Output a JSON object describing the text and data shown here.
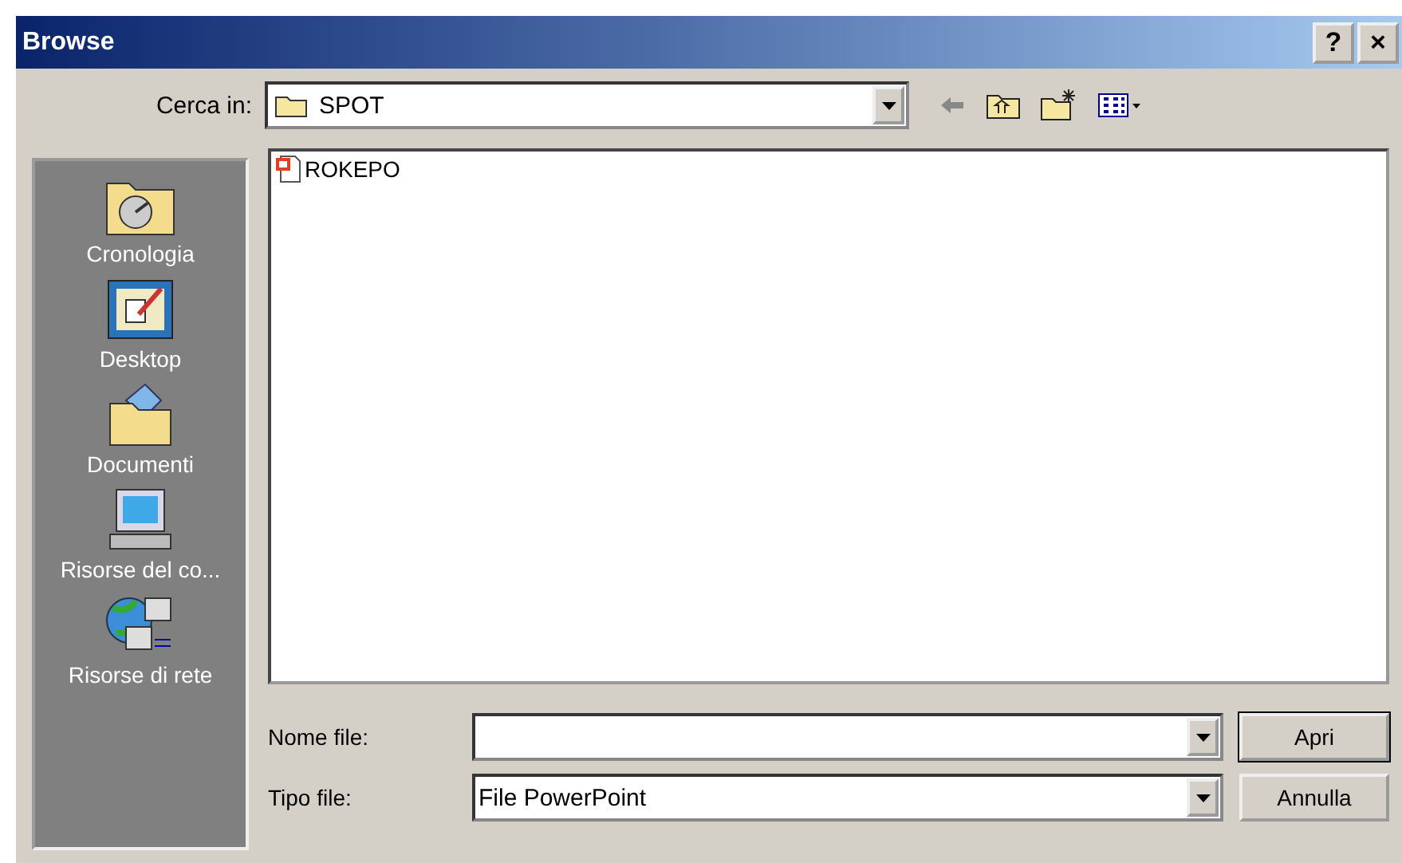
{
  "window": {
    "title": "Browse",
    "title_buttons": [
      "?",
      "×"
    ]
  },
  "look_in": {
    "label": "Cerca in:",
    "value": "SPOT"
  },
  "places": [
    {
      "label": "Cronologia",
      "kind": "history"
    },
    {
      "label": "Desktop",
      "kind": "desktop"
    },
    {
      "label": "Documenti",
      "kind": "documents"
    },
    {
      "label": "Risorse del co...",
      "kind": "computer"
    },
    {
      "label": "Risorse di rete",
      "kind": "network"
    }
  ],
  "files": [
    {
      "name": "ROKEPO"
    }
  ],
  "file_name": {
    "label": "Nome file:"
  },
  "file_type": {
    "label": "Tipo file:",
    "value": "File PowerPoint"
  },
  "buttons": [
    {
      "label": "Apri",
      "default": true
    },
    {
      "label": "Annulla",
      "default": false
    }
  ]
}
